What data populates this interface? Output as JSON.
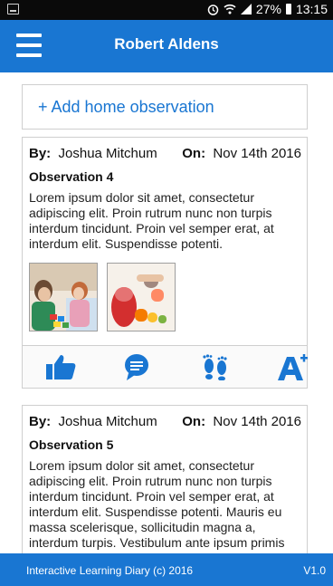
{
  "status_bar": {
    "battery": "27%",
    "time": "13:15"
  },
  "app_bar": {
    "title": "Robert Aldens",
    "menu_icon": "hamburger-menu-icon"
  },
  "add_observation": {
    "label": "+ Add home observation"
  },
  "observations": [
    {
      "by_label": "By:",
      "author": "Joshua Mitchum",
      "on_label": "On:",
      "date": "Nov 14th 2016",
      "title": "Observation 4",
      "body": "Lorem ipsum dolor sit amet, consectetur adipiscing elit. Proin rutrum nunc non turpis interdum tincidunt. Proin vel semper erat, at interdum elit. Suspendisse potenti."
    },
    {
      "by_label": "By:",
      "author": "Joshua Mitchum",
      "on_label": "On:",
      "date": "Nov 14th 2016",
      "title": "Observation 5",
      "body": "Lorem ipsum dolor sit amet, consectetur adipiscing elit. Proin rutrum nunc non turpis interdum tincidunt. Proin vel semper erat, at interdum elit. Suspendisse potenti. Mauris eu massa scelerisque, sollicitudin magna a, interdum turpis. Vestibulum ante ipsum primis"
    }
  ],
  "actions": [
    "thumbs-up-icon",
    "comment-icon",
    "footprints-icon",
    "grade-a-plus-icon"
  ],
  "footer": {
    "left": "Interactive Learning Diary (c) 2016",
    "right": "V1.0"
  },
  "colors": {
    "primary": "#1976d2",
    "status_bar": "#0a0a0a",
    "border": "#cfcfcf"
  }
}
